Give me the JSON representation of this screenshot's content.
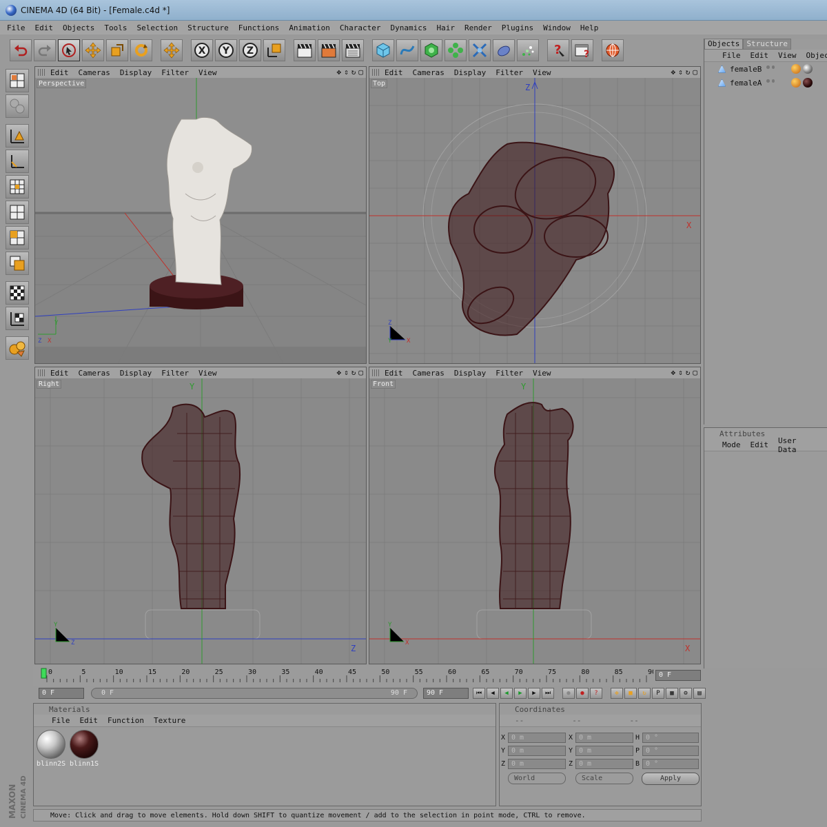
{
  "window": {
    "title": "CINEMA 4D (64 Bit) - [Female.c4d *]"
  },
  "menu": [
    "File",
    "Edit",
    "Objects",
    "Tools",
    "Selection",
    "Structure",
    "Functions",
    "Animation",
    "Character",
    "Dynamics",
    "Hair",
    "Render",
    "Plugins",
    "Window",
    "Help"
  ],
  "viewport_menu": [
    "Edit",
    "Cameras",
    "Display",
    "Filter",
    "View"
  ],
  "viewports": {
    "perspective": "Perspective",
    "top": "Top",
    "right": "Right",
    "front": "Front"
  },
  "axes": {
    "x": "X",
    "y": "Y",
    "z": "Z"
  },
  "objects_panel": {
    "tabs": [
      "Objects",
      "Structure"
    ],
    "menu": [
      "File",
      "Edit",
      "View",
      "Objects"
    ],
    "items": [
      "femaleB",
      "femaleA"
    ]
  },
  "attributes_panel": {
    "title": "Attributes",
    "menu": [
      "Mode",
      "Edit",
      "User Data"
    ]
  },
  "timeline": {
    "ticks": [
      "0",
      "5",
      "10",
      "15",
      "20",
      "25",
      "30",
      "35",
      "40",
      "45",
      "50",
      "55",
      "60",
      "65",
      "70",
      "75",
      "80",
      "85",
      "90"
    ],
    "current_frame": "0 F"
  },
  "playback": {
    "start": "0 F",
    "slider_start": "0 F",
    "slider_end": "90 F",
    "end": "90 F"
  },
  "materials_panel": {
    "title": "Materials",
    "menu": [
      "File",
      "Edit",
      "Function",
      "Texture"
    ],
    "items": [
      "blinn2S",
      "blinn1S"
    ]
  },
  "coordinates_panel": {
    "title": "Coordinates",
    "subheads": [
      "--",
      "--",
      "--"
    ],
    "rows": [
      {
        "a": "X",
        "av": "0 m",
        "b": "X",
        "bv": "0 m",
        "c": "H",
        "cv": "0 °"
      },
      {
        "a": "Y",
        "av": "0 m",
        "b": "Y",
        "bv": "0 m",
        "c": "P",
        "cv": "0 °"
      },
      {
        "a": "Z",
        "av": "0 m",
        "b": "Z",
        "bv": "0 m",
        "c": "B",
        "cv": "0 °"
      }
    ],
    "mode": "World",
    "scale": "Scale",
    "apply": "Apply"
  },
  "status": "Move: Click and drag to move elements. Hold down SHIFT to quantize movement / add to the selection in point mode, CTRL to remove.",
  "brand": {
    "line1": "MAXON",
    "line2": "CINEMA 4D"
  },
  "colors": {
    "wire": "#3b1416",
    "grid": "#7a7a7a",
    "axis_x": "#c0302a",
    "axis_y": "#2e9a2e",
    "axis_z": "#2f3fbf",
    "icon_orange": "#e8a020"
  }
}
